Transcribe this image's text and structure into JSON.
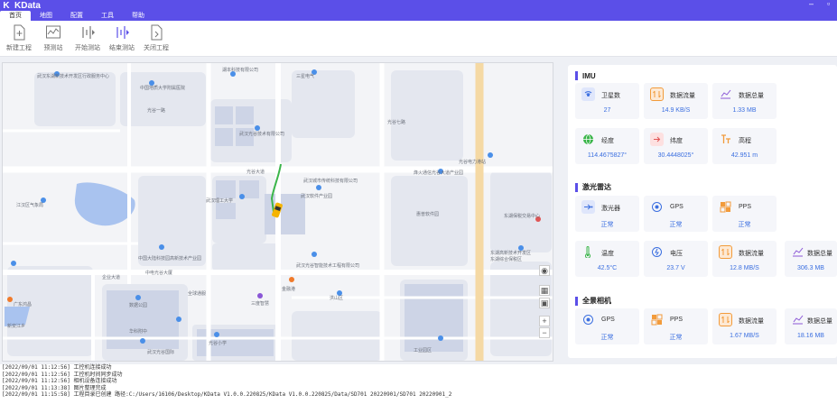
{
  "app": {
    "title": "KData",
    "logo": "K",
    "win_minimize": "–",
    "win_restore": "▫"
  },
  "menu": [
    "首页",
    "地图",
    "配置",
    "工具",
    "帮助"
  ],
  "toolbar": {
    "items": [
      {
        "label": "新建工程",
        "icon": "new-project-icon"
      },
      {
        "label": "预测站",
        "icon": "pre-test-icon"
      },
      {
        "label": "开始测站",
        "icon": "start-test-icon"
      },
      {
        "label": "结束测站",
        "icon": "end-test-icon"
      },
      {
        "label": "关闭工程",
        "icon": "close-project-icon"
      }
    ]
  },
  "map": {
    "pois": [
      "武汉东湖新技术开发区行政服务中心",
      "中国地质大学附属医院",
      "湖本科技有限公司",
      "三星电气",
      "武汉光谷技术有限公司",
      "江汉区气象局",
      "武汉理工大学",
      "光谷大道",
      "武汉城市传统科技有限公司",
      "烽火通信光谷大道产业园",
      "光谷电力港站",
      "武汉软件产业园",
      "惠普软件园",
      "东湖保税交易中心",
      "东湖高新技术开发区",
      "中国大陆科技园高新技术产业园",
      "中电光谷大厦",
      "光谷一路",
      "企业大道",
      "光谷七路",
      "武汉光谷智能技术工程有限公司",
      "金融港",
      "洪山区",
      "数据公园",
      "广东鸿昌",
      "新安江乡",
      "工业园区",
      "三度智慧",
      "华科附中",
      "光谷小学",
      "全球通服",
      "东湖综合保税区",
      "武汉光谷国际"
    ]
  },
  "imu": {
    "title": "IMU",
    "cards": [
      {
        "label": "卫星数",
        "value": "27",
        "icon": "satellite-icon"
      },
      {
        "label": "数据流量",
        "value": "14.9 KB/S",
        "icon": "data-flow-icon"
      },
      {
        "label": "数据总量",
        "value": "1.33 MB",
        "icon": "data-total-icon"
      },
      {
        "label": "经度",
        "value": "114.4675827°",
        "icon": "longitude-icon"
      },
      {
        "label": "纬度",
        "value": "30.4448025°",
        "icon": "latitude-icon"
      },
      {
        "label": "高程",
        "value": "42.951 m",
        "icon": "elevation-icon"
      }
    ]
  },
  "lidar": {
    "title": "激光雷达",
    "cards": [
      {
        "label": "激光器",
        "value": "正常",
        "icon": "laser-icon"
      },
      {
        "label": "GPS",
        "value": "正常",
        "icon": "gps-icon"
      },
      {
        "label": "PPS",
        "value": "正常",
        "icon": "pps-icon"
      },
      {
        "label": "温度",
        "value": "42.5°C",
        "icon": "temperature-icon"
      },
      {
        "label": "电压",
        "value": "23.7 V",
        "icon": "voltage-icon"
      },
      {
        "label": "数据流量",
        "value": "12.8 MB/S",
        "icon": "data-flow-icon"
      },
      {
        "label": "数据总量",
        "value": "306.3 MB",
        "icon": "data-total-icon"
      }
    ]
  },
  "camera": {
    "title": "全景相机",
    "cards": [
      {
        "label": "GPS",
        "value": "正常",
        "icon": "gps-icon"
      },
      {
        "label": "PPS",
        "value": "正常",
        "icon": "pps-icon"
      },
      {
        "label": "数据流量",
        "value": "1.67 MB/S",
        "icon": "data-flow-icon"
      },
      {
        "label": "数据总量",
        "value": "18.16 MB",
        "icon": "data-total-icon"
      }
    ]
  },
  "log": [
    "[2022/09/01 11:12:56] 工控机连接成功",
    "[2022/09/01 11:12:56] 工控机时间同步成功",
    "[2022/09/01 11:12:56] 相机设备连接成功",
    "[2022/09/01 11:13:38] 图片整理完成",
    "[2022/09/01 11:15:58] 工程目录已创建 路径:C:/Users/16106/Desktop/KData V1.0.0.220825/KData V1.0.0.220825/Data/SD701 20220901/SD701 20220901_2"
  ],
  "colors": {
    "accent": "#5b4fe8",
    "value_blue": "#3b6fe0"
  }
}
